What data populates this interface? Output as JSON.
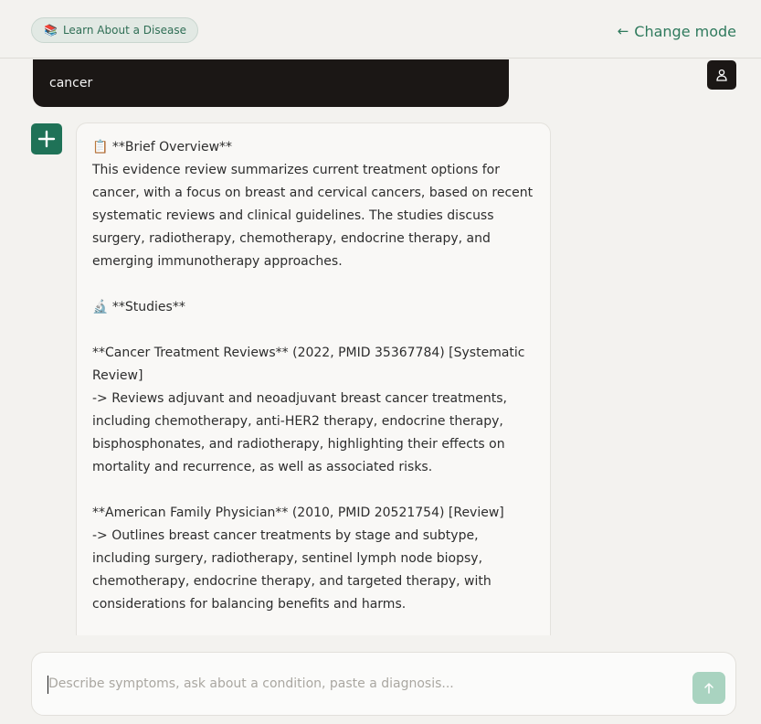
{
  "header": {
    "mode_icon": "books-icon",
    "mode_label": "Learn About a Disease",
    "change_mode_label": "Change mode",
    "change_mode_icon": "arrow-left-icon"
  },
  "conversation": {
    "user_message": "cancer",
    "user_avatar_icon": "user-icon",
    "bot_avatar_icon": "plus-icon",
    "bot_response": {
      "overview_icon": "📋",
      "overview_heading": "**Brief Overview**",
      "overview_text": "This evidence review summarizes current treatment options for cancer, with a focus on breast and cervical cancers, based on recent systematic reviews and clinical guidelines. The studies discuss surgery, radiotherapy, chemotherapy, endocrine therapy, and emerging immunotherapy approaches.",
      "studies_icon": "🔬",
      "studies_heading": "**Studies**",
      "studies": [
        {
          "citation": "**Cancer Treatment Reviews** (2022, PMID 35367784) [Systematic Review]",
          "summary": "-> Reviews adjuvant and neoadjuvant breast cancer treatments, including chemotherapy, anti-HER2 therapy, endocrine therapy, bisphosphonates, and radiotherapy, highlighting their effects on mortality and recurrence, as well as associated risks."
        },
        {
          "citation": "**American Family Physician** (2010, PMID 20521754) [Review]",
          "summary": "-> Outlines breast cancer treatments by stage and subtype, including surgery, radiotherapy, sentinel lymph node biopsy, chemotherapy, endocrine therapy, and targeted therapy, with considerations for balancing benefits and harms."
        }
      ]
    }
  },
  "composer": {
    "placeholder": "Describe symptoms, ask about a condition, paste a diagnosis...",
    "send_icon": "arrow-up-icon"
  },
  "colors": {
    "accent": "#1f7257",
    "accent_light": "#a9d3c0",
    "dark": "#1b1715",
    "background": "#f3f2ef"
  }
}
